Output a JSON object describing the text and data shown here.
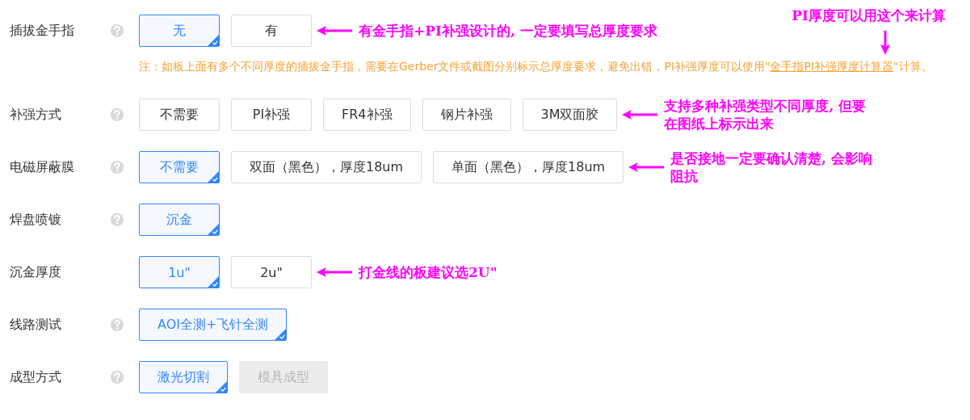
{
  "fields": [
    {
      "label": "插拔金手指",
      "help": true,
      "options": [
        {
          "label": "无",
          "selected": true,
          "disabled": false
        },
        {
          "label": "有",
          "selected": false,
          "disabled": false
        }
      ],
      "annotation": {
        "lines": [
          "有金手指+PI补强设计的, 一定要填写总厚度要求"
        ]
      },
      "note": [
        {
          "kind": "text",
          "text": "注：如板上面有多个不同厚度的插拔金手指，需要在Gerber文件或截图分别标示总厚度要求，避免出错，PI补强厚度可以使用\""
        },
        {
          "kind": "link",
          "text": "金手指PI补强厚度计算器"
        },
        {
          "kind": "text",
          "text": "\"计算。"
        }
      ]
    },
    {
      "label": "补强方式",
      "help": true,
      "options": [
        {
          "label": "不需要",
          "selected": false,
          "disabled": false
        },
        {
          "label": "PI补强",
          "selected": false,
          "disabled": false
        },
        {
          "label": "FR4补强",
          "selected": false,
          "disabled": false
        },
        {
          "label": "钢片补强",
          "selected": false,
          "disabled": false
        },
        {
          "label": "3M双面胶",
          "selected": false,
          "disabled": false
        }
      ],
      "annotation": {
        "lines": [
          "支持多种补强类型不同厚度, 但要",
          "在图纸上标示出来"
        ]
      }
    },
    {
      "label": "电磁屏蔽膜",
      "help": true,
      "options": [
        {
          "label": "不需要",
          "selected": true,
          "disabled": false
        },
        {
          "label": "双面（黑色），厚度18um",
          "selected": false,
          "disabled": false
        },
        {
          "label": "单面（黑色），厚度18um",
          "selected": false,
          "disabled": false
        }
      ],
      "annotation": {
        "lines": [
          "是否接地一定要确认清楚, 会影响",
          "阻抗"
        ]
      }
    },
    {
      "label": "焊盘喷镀",
      "help": true,
      "options": [
        {
          "label": "沉金",
          "selected": true,
          "disabled": false
        }
      ]
    },
    {
      "label": "沉金厚度",
      "help": false,
      "options": [
        {
          "label": "1u\"",
          "selected": true,
          "disabled": false
        },
        {
          "label": "2u\"",
          "selected": false,
          "disabled": false
        }
      ],
      "annotation": {
        "lines": [
          "打金线的板建议选2U\""
        ]
      }
    },
    {
      "label": "线路测试",
      "help": true,
      "options": [
        {
          "label": "AOI全测+飞针全测",
          "selected": true,
          "disabled": false
        }
      ]
    },
    {
      "label": "成型方式",
      "help": true,
      "options": [
        {
          "label": "激光切割",
          "selected": true,
          "disabled": false
        },
        {
          "label": "模具成型",
          "selected": false,
          "disabled": true
        }
      ]
    }
  ],
  "overlay_annotation": {
    "lines": [
      "PI厚度可以用这个来计算"
    ]
  }
}
